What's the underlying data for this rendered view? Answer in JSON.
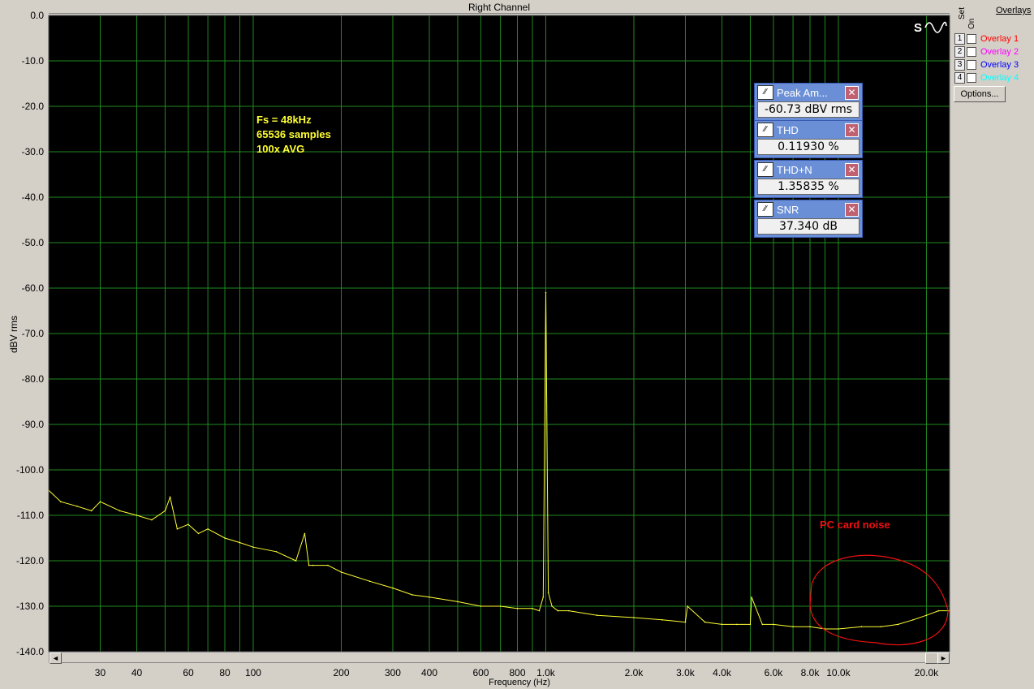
{
  "window": {
    "title": "Right Channel"
  },
  "annotations": {
    "fs": "Fs = 48kHz",
    "samples": "65536 samples",
    "avg": "100x AVG",
    "pc_noise": "PC card noise"
  },
  "meters": [
    {
      "name": "Peak Am...",
      "value": "-60.73 dBV rms"
    },
    {
      "name": "THD",
      "value": "0.11930 %"
    },
    {
      "name": "THD+N",
      "value": "1.35835 %"
    },
    {
      "name": "SNR",
      "value": "37.340 dB"
    }
  ],
  "overlays": {
    "header_set": "Set",
    "header_on": "On",
    "header_overlays": "Overlays",
    "items": [
      {
        "num": "1",
        "label": "Overlay 1",
        "color": "#ff0000"
      },
      {
        "num": "2",
        "label": "Overlay 2",
        "color": "#ff00ff"
      },
      {
        "num": "3",
        "label": "Overlay 3",
        "color": "#0000ff"
      },
      {
        "num": "4",
        "label": "Overlay 4",
        "color": "#00ffff"
      }
    ],
    "options_label": "Options..."
  },
  "scroll": {
    "left": "◄",
    "right": "►"
  },
  "chart_data": {
    "type": "line",
    "title": "Right Channel",
    "xlabel": "Frequency (Hz)",
    "ylabel": "dBV rms",
    "xscale": "log",
    "xlim": [
      20,
      24000
    ],
    "ylim": [
      -140,
      0
    ],
    "grid": true,
    "background": "#000000",
    "grid_color": "#1f8a1f",
    "line_color": "#ffff33",
    "yticks": [
      0,
      -10,
      -20,
      -30,
      -40,
      -50,
      -60,
      -70,
      -80,
      -90,
      -100,
      -110,
      -120,
      -130,
      -140
    ],
    "ytick_labels": [
      "0.0",
      "-10.0",
      "-20.0",
      "-30.0",
      "-40.0",
      "-50.0",
      "-60.0",
      "-70.0",
      "-80.0",
      "-90.0",
      "-100.0",
      "-110.0",
      "-120.0",
      "-130.0",
      "-140.0"
    ],
    "xticks": [
      30,
      40,
      60,
      80,
      100,
      200,
      300,
      400,
      600,
      800,
      1000,
      2000,
      3000,
      4000,
      6000,
      8000,
      10000,
      20000
    ],
    "xtick_labels": [
      "30",
      "40",
      "60",
      "80",
      "100",
      "200",
      "300",
      "400",
      "600",
      "800",
      "1.0k",
      "2.0k",
      "3.0k",
      "4.0k",
      "6.0k",
      "8.0k",
      "10.0k",
      "20.0k"
    ],
    "series": [
      {
        "x": [
          20,
          22,
          25,
          28,
          30,
          35,
          40,
          45,
          50,
          52,
          55,
          60,
          65,
          70,
          80,
          90,
          100,
          120,
          140,
          150,
          155,
          160,
          180,
          200,
          250,
          300,
          350,
          400,
          500,
          600,
          700,
          800,
          900,
          950,
          980,
          1000,
          1020,
          1050,
          1100,
          1200,
          1500,
          2000,
          2500,
          3000,
          3050,
          3500,
          4000,
          4500,
          5000,
          5050,
          5500,
          6000,
          7000,
          8000,
          9000,
          10000,
          12000,
          14000,
          16000,
          18000,
          20000,
          22000,
          24000
        ],
        "y": [
          -104.5,
          -107,
          -108,
          -109,
          -107,
          -109,
          -110,
          -111,
          -109,
          -106,
          -113,
          -112,
          -114,
          -113,
          -115,
          -116,
          -117,
          -118,
          -120,
          -114,
          -121,
          -121,
          -121,
          -122.5,
          -124.5,
          -126,
          -127.5,
          -128,
          -129,
          -130,
          -130,
          -130.5,
          -130.5,
          -131,
          -128,
          -61,
          -127,
          -130,
          -131,
          -131,
          -132,
          -132.5,
          -133,
          -133.5,
          -130,
          -133.5,
          -134,
          -134,
          -134,
          -128,
          -134,
          -134,
          -134.5,
          -134.5,
          -135,
          -135,
          -134.5,
          -134.5,
          -134,
          -133,
          -132,
          -131,
          -131
        ]
      }
    ]
  }
}
